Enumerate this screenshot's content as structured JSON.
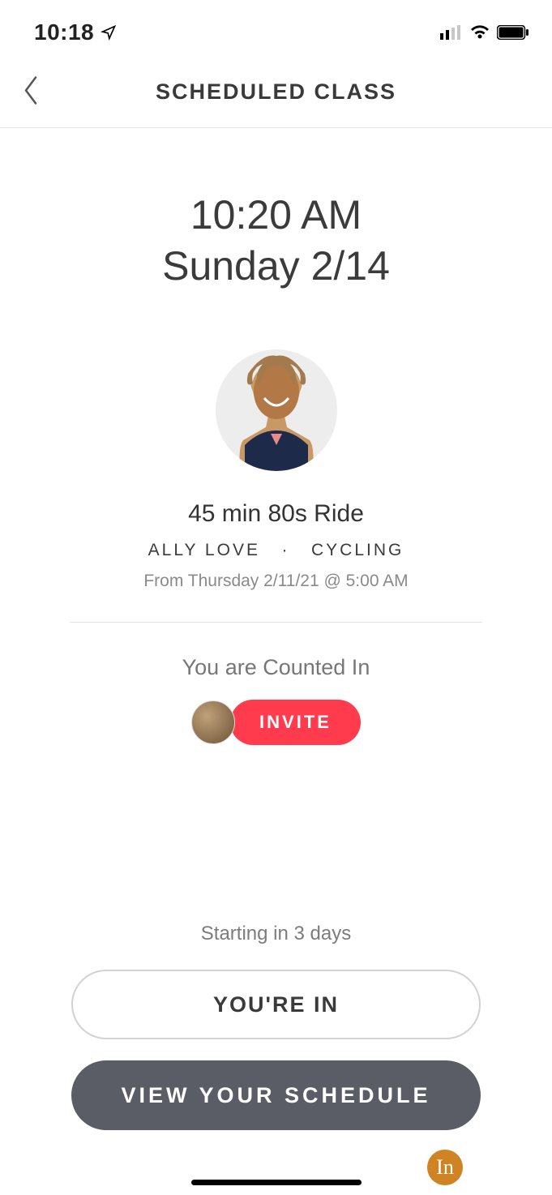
{
  "status": {
    "time": "10:18"
  },
  "nav": {
    "title": "SCHEDULED CLASS"
  },
  "schedule": {
    "time": "10:20 AM",
    "date": "Sunday 2/14"
  },
  "class": {
    "title": "45 min 80s Ride",
    "instructor": "ALLY LOVE",
    "separator": "·",
    "category": "CYCLING",
    "from_line": "From Thursday 2/11/21 @ 5:00 AM"
  },
  "counted": {
    "label": "You are Counted In",
    "invite_label": "INVITE"
  },
  "footer": {
    "starting": "Starting in 3 days",
    "youre_in": "YOU'RE IN",
    "view_schedule": "VIEW YOUR SCHEDULE"
  },
  "badge": {
    "text": "In"
  }
}
